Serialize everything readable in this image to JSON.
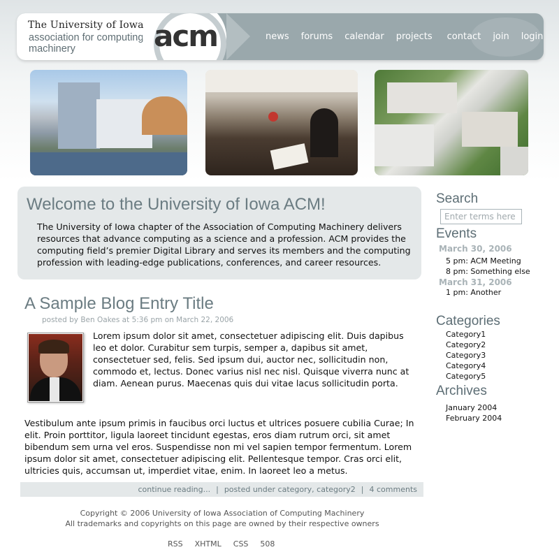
{
  "header": {
    "university_name": "The University of Iowa",
    "association_name": "association for computing machinery",
    "logo_text": "acm",
    "nav": [
      "news",
      "forums",
      "calendar",
      "projects",
      "contact",
      "join",
      "login"
    ]
  },
  "welcome": {
    "title": "Welcome to the University of Iowa ACM!",
    "body": "The University of Iowa chapter of the Association of Computing Machinery delivers resources that advance computing as a science and a profession. ACM provides the computing field’s premier Digital Library and serves its members and the computing profession with leading-edge publications, conferences, and career resources."
  },
  "blog": {
    "title": "A Sample Blog Entry Title",
    "byline": "posted by Ben Oakes at 5:36 pm on March 22, 2006",
    "paragraph1": "Lorem ipsum dolor sit amet, consectetuer adipiscing elit. Duis dapibus leo et dolor. Curabitur sem turpis, semper a, dapibus sit amet, consectetuer sed, felis. Sed ipsum dui, auctor nec, sollicitudin non, commodo et, lectus. Donec varius nisl nec nisl. Quisque viverra nunc at diam. Aenean purus. Maecenas quis dui vitae lacus sollicitudin porta.",
    "paragraph2": "Vestibulum ante ipsum primis in faucibus orci luctus et ultrices posuere cubilia Curae; In elit. Proin porttitor, ligula laoreet tincidunt egestas, eros diam rutrum orci, sit amet bibendum sem urna vel eros. Suspendisse non mi vel sapien tempor fermentum. Lorem ipsum dolor sit amet, consectetuer adipiscing elit. Pellentesque tempor. Cras orci elit, ultricies quis, accumsan ut, imperdiet vitae, enim. In laoreet leo a metus.",
    "continue_reading": "continue reading...",
    "separator": "|",
    "posted_under_prefix": "posted under",
    "category_a": "category",
    "category_b": "category2",
    "comments": "4 comments"
  },
  "footer": {
    "copyright": "Copyright © 2006 University of Iowa Association of Computing Machinery",
    "trademarks": "All trademarks and copyrights on this page are owned by their respective owners",
    "links": [
      "RSS",
      "XHTML",
      "CSS",
      "508"
    ]
  },
  "sidebar": {
    "search_heading": "Search",
    "search_placeholder": "Enter terms here",
    "events_heading": "Events",
    "event_dates": [
      "March 30, 2006",
      "March 31, 2006"
    ],
    "events": [
      "5 pm: ACM Meeting",
      "8 pm: Something else",
      "1 pm: Another"
    ],
    "categories_heading": "Categories",
    "categories": [
      "Category1",
      "Category2",
      "Category3",
      "Category4",
      "Category5"
    ],
    "archives_heading": "Archives",
    "archives": [
      "January 2004",
      "February 2004"
    ]
  },
  "colors": {
    "header_bg": "#9aa8ac",
    "heading_gray": "#6b7c82",
    "panel_bg": "#e4e8e9"
  }
}
